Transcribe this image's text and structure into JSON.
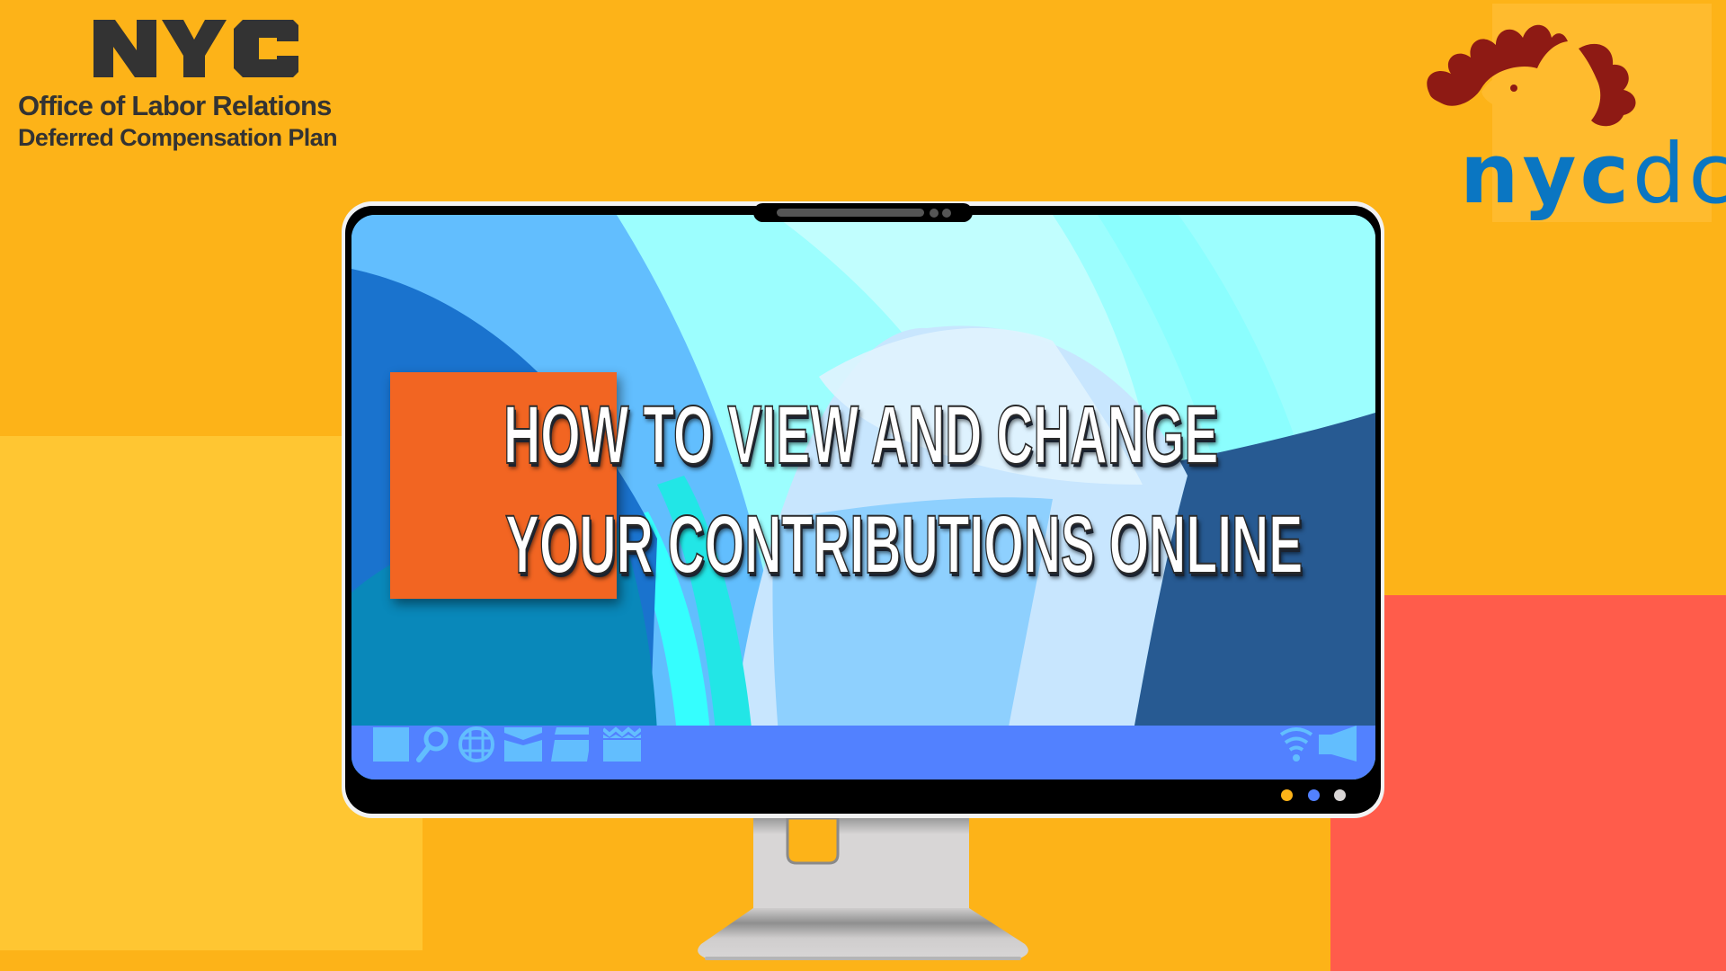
{
  "header": {
    "left_logo": {
      "mark": "NYC",
      "line1": "Office of Labor Relations",
      "line2": "Deferred Compensation Plan"
    },
    "right_logo": {
      "mascot": "squirrel-logo",
      "text_bold": "nyc",
      "text_light": "dcp"
    }
  },
  "main": {
    "title_line1": "HOW TO VIEW AND CHANGE",
    "title_line2": "YOUR CONTRIBUTIONS ONLINE"
  },
  "monitor": {
    "taskbar_left_icons": [
      "window-icon",
      "search-icon",
      "globe-icon",
      "mail-icon",
      "folder-icon",
      "calendar-icon"
    ],
    "taskbar_right_icons": [
      "wifi-icon",
      "speaker-icon"
    ],
    "indicator_dots": [
      "#FDB318",
      "#5281FF",
      "#D9D6D6"
    ]
  },
  "colors": {
    "background": "#FDB318",
    "accent_orange": "#F26522",
    "accent_red": "#FF5C4B",
    "taskbar": "#5281FF",
    "icon": "#62BEFE",
    "logo_blue": "#0A76C2",
    "logo_red": "#8E1A14"
  }
}
